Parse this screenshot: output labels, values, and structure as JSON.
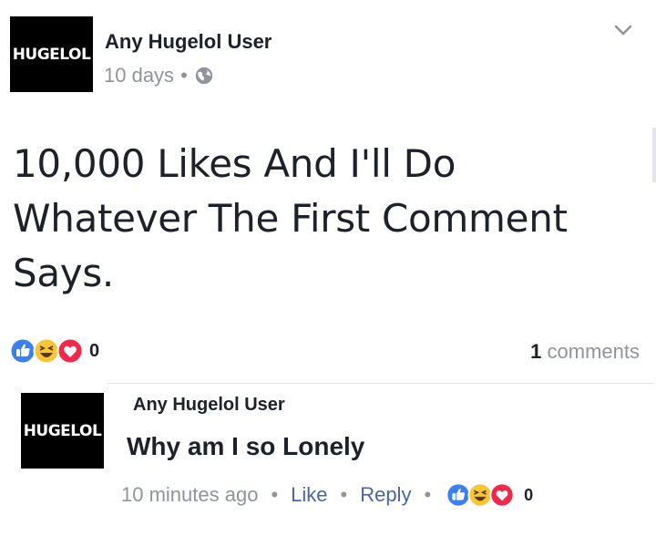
{
  "post": {
    "avatar_text": "HUGELOL",
    "author": "Any Hugelol User",
    "time": "10 days",
    "separator": "•",
    "text": "10,000 Likes And I'll Do Whatever The First Comment Says.",
    "reaction_count": "0",
    "comments_number": "1",
    "comments_label": "comments"
  },
  "comment": {
    "avatar_text": "HUGELOL",
    "author": "Any Hugelol User",
    "text": "Why am I so Lonely",
    "time": "10 minutes ago",
    "like_label": "Like",
    "reply_label": "Reply",
    "separator": "•",
    "reaction_count": "0"
  },
  "icons": {
    "options": "chevron-down-icon",
    "privacy": "globe-icon",
    "reactions": [
      "like-icon",
      "haha-icon",
      "love-icon"
    ]
  },
  "colors": {
    "like": "#3b7ff0",
    "haha": "#f7c53a",
    "love": "#f0284a",
    "meta": "#90949c",
    "action": "#4b67a1"
  }
}
